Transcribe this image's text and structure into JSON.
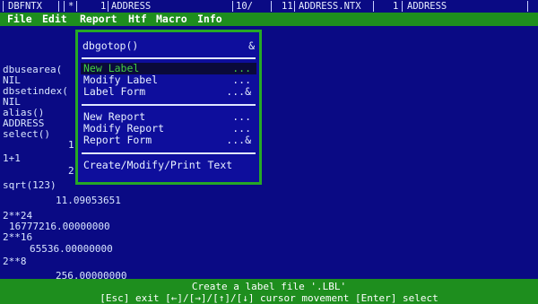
{
  "status": {
    "program": "DBFNTX",
    "mark": "*",
    "area": "1",
    "alias": "ADDRESS",
    "record": "10/",
    "index": "11",
    "index_file": "ADDRESS.NTX",
    "area2": "1",
    "alias2": "ADDRESS"
  },
  "menubar": {
    "items": [
      "File",
      "Edit",
      "Report",
      "Htf",
      "Macro",
      "Info"
    ]
  },
  "console": {
    "lines": [
      "dbusearea(",
      "NIL",
      "dbsetindex(",
      "NIL",
      "alias()",
      "ADDRESS",
      "select()",
      "1",
      "1+1",
      "2",
      "sqrt(123)",
      "11.09053651",
      "2**24",
      "16777216.00000000",
      "2**16",
      "65536.00000000",
      "2**8",
      "256.00000000"
    ]
  },
  "popup": {
    "header": "dbgotop()",
    "header_suffix": "&",
    "items": [
      {
        "label": "New Label",
        "suffix": "..."
      },
      {
        "label": "Modify Label",
        "suffix": "..."
      },
      {
        "label": "Label Form",
        "suffix": "...&"
      },
      {
        "label": "New Report",
        "suffix": "..."
      },
      {
        "label": "Modify Report",
        "suffix": "..."
      },
      {
        "label": "Report Form",
        "suffix": "...&"
      },
      {
        "label": "Create/Modify/Print Text",
        "suffix": ""
      }
    ],
    "selected": "New Label"
  },
  "bottom": {
    "message": "Create a label file '.LBL'",
    "help": "[Esc] exit  [←]/[→]/[↑]/[↓] cursor movement  [Enter] select"
  },
  "colors": {
    "background": "#0a0a84",
    "menubar": "#1e8e1e",
    "popup_border": "#26a826",
    "highlight_text": "#43d043"
  }
}
